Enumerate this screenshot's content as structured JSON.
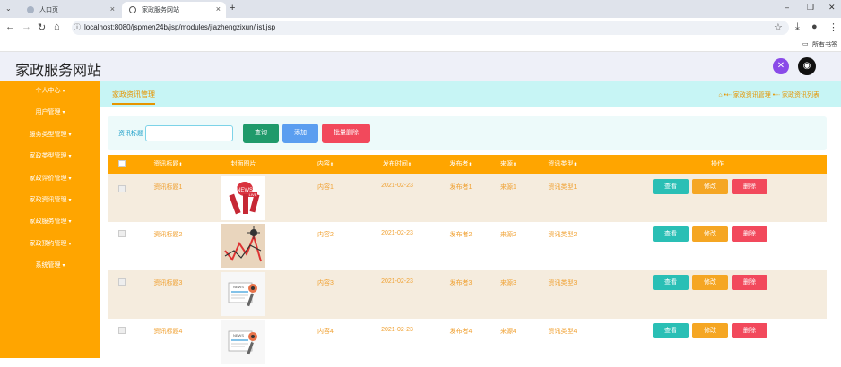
{
  "browser": {
    "tabs": [
      {
        "title": "人口页",
        "active": false
      },
      {
        "title": "家政服务网站",
        "active": true
      }
    ],
    "url": "localhost:8080/jspmen24b/jsp/modules/jiazhengzixun/list.jsp",
    "bookmarks_label": "所有书签"
  },
  "site": {
    "title": "家政服务网站"
  },
  "sidebar": {
    "items": [
      {
        "label": "个人中心"
      },
      {
        "label": "用户管理"
      },
      {
        "label": "服务类型管理"
      },
      {
        "label": "家政类型管理"
      },
      {
        "label": "家政评价管理"
      },
      {
        "label": "家政资讯管理"
      },
      {
        "label": "家政服务管理"
      },
      {
        "label": "家政预约管理"
      },
      {
        "label": "系统管理"
      }
    ]
  },
  "breadcrumb": {
    "section_title": "家政资讯管理",
    "crumb1": "家政资讯管理",
    "crumb2": "家政资讯列表"
  },
  "search": {
    "label": "资讯标题",
    "value": "",
    "query_label": "查询",
    "add_label": "添加",
    "batch_delete_label": "批量删除"
  },
  "table": {
    "headers": {
      "title": "资讯标题",
      "image": "封面图片",
      "content": "内容",
      "time": "发布时间",
      "author": "发布者",
      "source": "来源",
      "type": "资讯类型",
      "ops": "操作"
    },
    "rows": [
      {
        "title": "资讯标题1",
        "content": "内容1",
        "time": "2021-02-23",
        "author": "发布者1",
        "source": "来源1",
        "type": "资讯类型1"
      },
      {
        "title": "资讯标题2",
        "content": "内容2",
        "time": "2021-02-23",
        "author": "发布者2",
        "source": "来源2",
        "type": "资讯类型2"
      },
      {
        "title": "资讯标题3",
        "content": "内容3",
        "time": "2021-02-23",
        "author": "发布者3",
        "source": "来源3",
        "type": "资讯类型3"
      },
      {
        "title": "资讯标题4",
        "content": "内容4",
        "time": "2021-02-23",
        "author": "发布者4",
        "source": "来源4",
        "type": "资讯类型4"
      }
    ],
    "view_label": "查看",
    "edit_label": "修改",
    "delete_label": "删除"
  },
  "colors": {
    "sidebar": "#ffa500",
    "header_bg": "#eef0f8",
    "breadcrumb_bg": "#c7f5f5",
    "accent": "#e69500",
    "view_btn": "#2abfb5",
    "edit_btn": "#f5a623",
    "delete_btn": "#f2495c",
    "row_alt": "#f5ecde"
  }
}
